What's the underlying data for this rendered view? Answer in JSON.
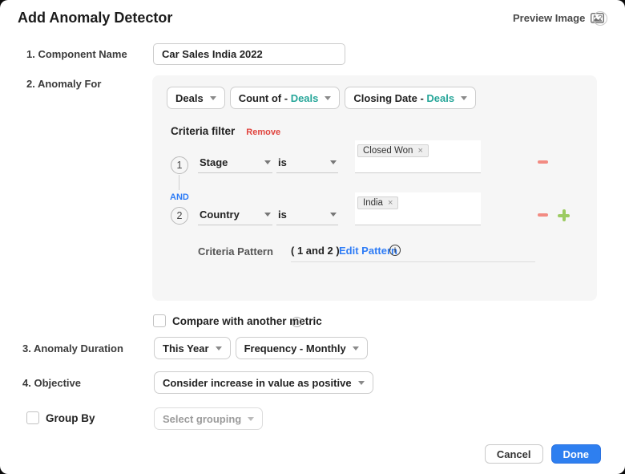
{
  "header": {
    "title": "Add Anomaly Detector",
    "preview_image_label": "Preview Image"
  },
  "component_name": {
    "label": "1. Component Name",
    "value": "Car Sales India 2022"
  },
  "anomaly_for": {
    "label": "2. Anomaly For",
    "base_table": {
      "text": "Deals"
    },
    "aggregate": {
      "prefix": "Count of - ",
      "accent": "Deals"
    },
    "date_field": {
      "prefix": "Closing Date - ",
      "accent": "Deals"
    },
    "criteria_filter": {
      "title": "Criteria filter",
      "remove_label": "Remove",
      "conjunction": "AND",
      "rows": [
        {
          "index": "1",
          "field": "Stage",
          "operator": "is",
          "chip": "Closed Won"
        },
        {
          "index": "2",
          "field": "Country",
          "operator": "is",
          "chip": "India"
        }
      ],
      "pattern_label": "Criteria Pattern",
      "pattern_value": "( 1 and 2 )",
      "edit_pattern_label": "Edit Pattern"
    }
  },
  "compare": {
    "label": "Compare with another metric"
  },
  "anomaly_duration": {
    "label": "3. Anomaly Duration",
    "period": "This Year",
    "frequency": "Frequency - Monthly"
  },
  "objective": {
    "label": "4. Objective",
    "value": "Consider increase in value as positive"
  },
  "group_by": {
    "label": "Group By",
    "placeholder": "Select grouping"
  },
  "footer": {
    "cancel": "Cancel",
    "done": "Done"
  },
  "glyphs": {
    "chip_close": "×",
    "help": "?",
    "info": "i"
  },
  "colors": {
    "accent_teal": "#26a699",
    "link_blue": "#2e7cf6",
    "remove_red": "#e0433d",
    "minus_pink": "#f28b82",
    "plus_green": "#9ccb62",
    "done_blue": "#2e7ff0",
    "panel_bg": "#f6f6f6"
  }
}
